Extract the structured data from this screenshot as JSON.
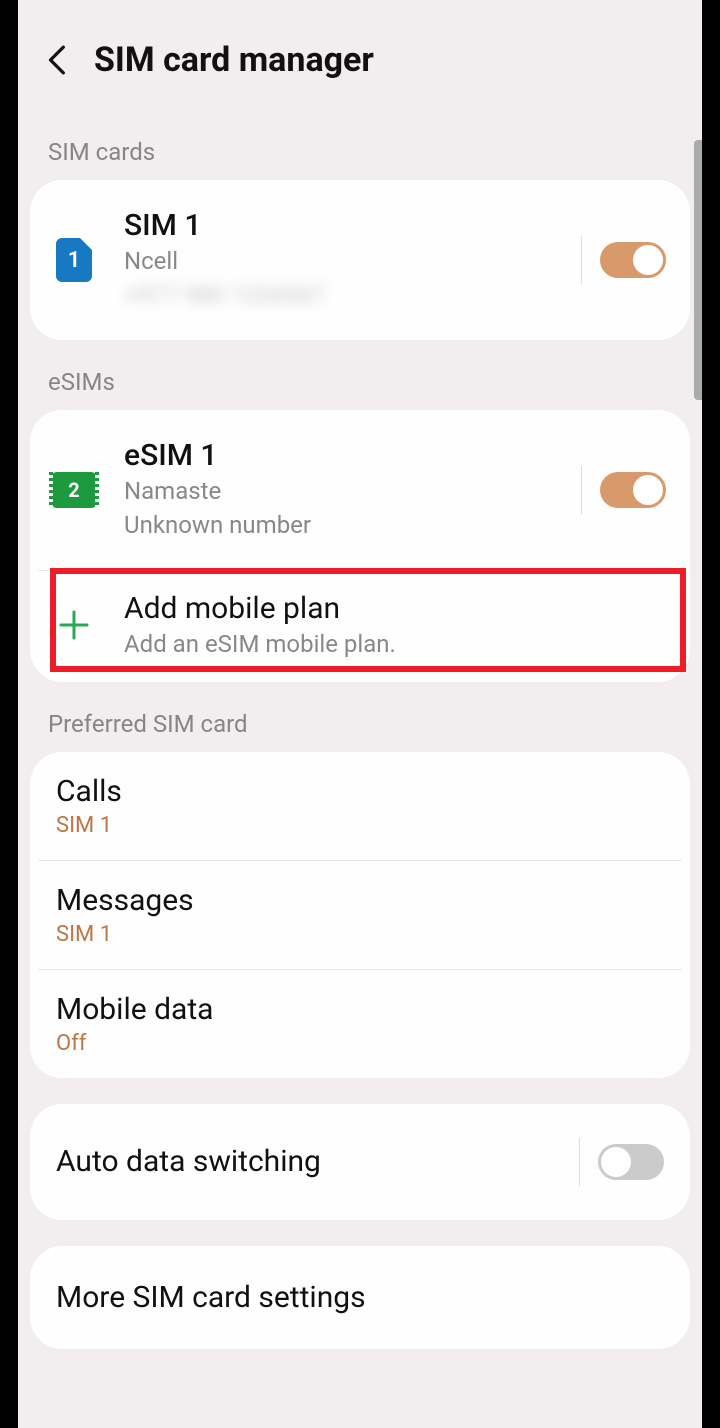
{
  "header": {
    "title": "SIM card manager"
  },
  "sections": {
    "sim_cards_header": "SIM cards",
    "esims_header": "eSIMs",
    "preferred_header": "Preferred SIM card"
  },
  "sim1": {
    "badge": "1",
    "title": "SIM 1",
    "carrier": "Ncell",
    "number_masked": "+977 980 1234567",
    "enabled": true
  },
  "esim1": {
    "badge": "2",
    "title": "eSIM 1",
    "carrier": "Namaste",
    "number": "Unknown number",
    "enabled": true
  },
  "add_plan": {
    "title": "Add mobile plan",
    "subtitle": "Add an eSIM mobile plan."
  },
  "preferred": {
    "calls": {
      "label": "Calls",
      "value": "SIM 1"
    },
    "messages": {
      "label": "Messages",
      "value": "SIM 1"
    },
    "mobile_data": {
      "label": "Mobile data",
      "value": "Off"
    }
  },
  "auto_switch": {
    "label": "Auto data switching",
    "enabled": false
  },
  "more_settings": {
    "label": "More SIM card settings"
  }
}
